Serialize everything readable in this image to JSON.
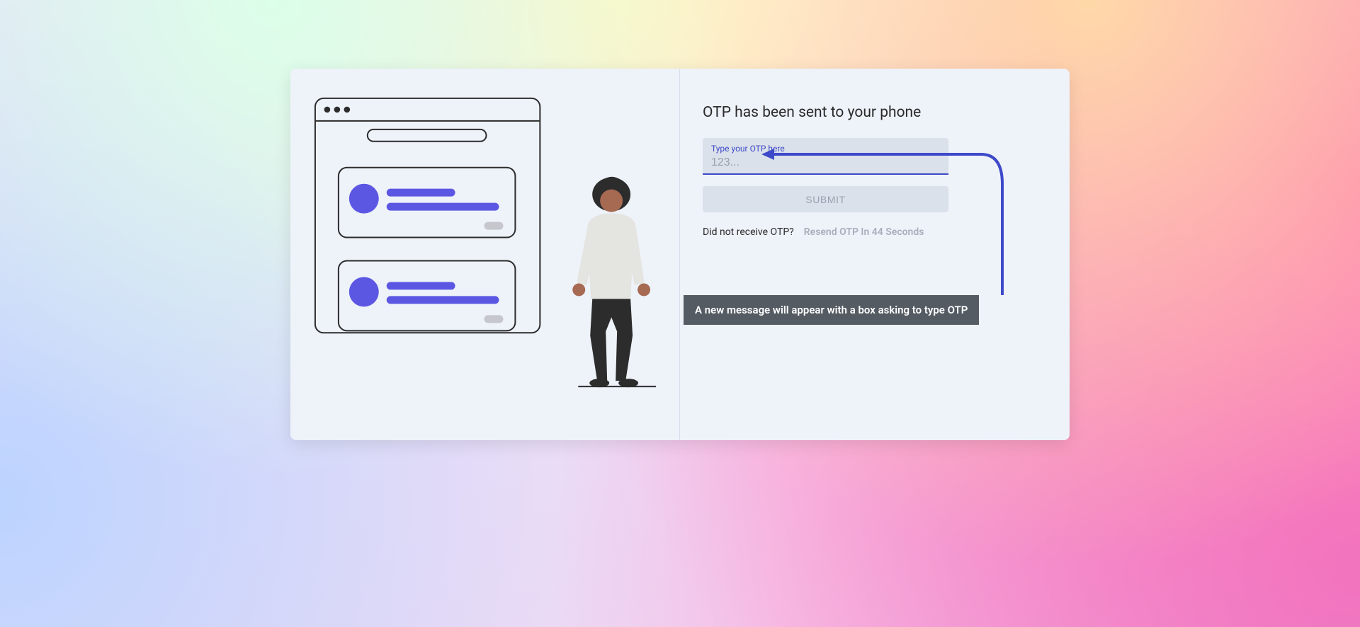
{
  "form": {
    "heading": "OTP has been sent to your phone",
    "field_label": "Type your OTP here",
    "placeholder": "123...",
    "submit_label": "SUBMIT",
    "resend_question": "Did not receive OTP?",
    "resend_countdown": "Resend OTP In 44 Seconds"
  },
  "callout": {
    "text": "A new message will appear with a box asking to type OTP"
  },
  "colors": {
    "accent": "#3d49c9",
    "illustration_accent": "#5c57e3"
  }
}
